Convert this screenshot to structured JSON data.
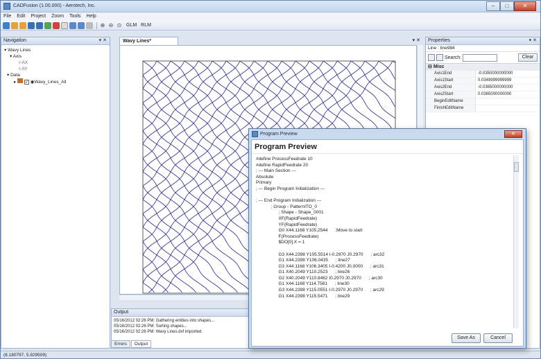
{
  "window": {
    "title": "CADFusion (1.00.000) - Aerotech, Inc."
  },
  "menu": [
    "File",
    "Edit",
    "Project",
    "Zoom",
    "Tools",
    "Help"
  ],
  "toolbar": {
    "glm": "GLM",
    "rlm": "RLM"
  },
  "navigation": {
    "title": "Navigation",
    "pin": "▾ ✕",
    "tree": {
      "root": "Wavy Lines",
      "axis": "Axis",
      "ax": "AX",
      "ay": "AY",
      "data": "Data",
      "layer": "Wavy_Lines_All"
    }
  },
  "document": {
    "tab": "Wavy Lines*",
    "controls": "▾ ✕"
  },
  "output": {
    "title": "Output",
    "lines": [
      "05/16/2012 02:26 PM: Gathering entities into shapes...",
      "05/16/2012 02:26 PM: Sorting shapes...",
      "05/16/2012 02:26 PM: Wavy Lines.dxf imported."
    ],
    "tabs": [
      "Errors",
      "Output"
    ]
  },
  "properties": {
    "title": "Properties",
    "pin": "▾ ✕",
    "subject": "Line : line984",
    "search_label": "Search:",
    "clear": "Clear",
    "group": "Misc",
    "rows": [
      {
        "name": "Axis1End",
        "value": "-0.0350000000000"
      },
      {
        "name": "Axis1Start",
        "value": "0.0349999999999"
      },
      {
        "name": "Axis2End",
        "value": "-0.0365000000000"
      },
      {
        "name": "Axis2Start",
        "value": "0.0365000000000"
      },
      {
        "name": "BeginEditName",
        "value": ""
      },
      {
        "name": "FinishEditName",
        "value": ""
      }
    ]
  },
  "dialog": {
    "title": "Program Preview",
    "heading": "Program Preview",
    "code": [
      "#define ProcessFeedrate 10",
      "#define RapidFeedrate 20",
      "; --- Main Section ---",
      "Absolute",
      "Primary",
      "; --- Begin Program Initialization ---",
      "",
      "; --- End Program Initialization ---",
      "            ; Group - PatternITO_0",
      "                  ; Shape - Shape_0001",
      "                  XF(RapidFeedrate)",
      "                  YF(RapidFeedrate)",
      "                  G0 X44.1168 Y105.2544      ;Move to start",
      "                  F(ProcessFeedrate)",
      "                  $DO[0].X = 1",
      "",
      "                  G3 X44.2398 Y105.5514 I-0.2970 J0.2970      ; arc32",
      "                  G1 X44.2398 Y106.0435      ; line27",
      "                  G3 X44.1168 Y106.3405 I-0.4200 J0.0000      ; arc31",
      "                  G1 X40.2049 Y110.2523      ; line26",
      "                  G2 X40.2049 Y110.8462 I0.2970 J0.2970      ; arc30",
      "                  G1 X44.1168 Y114.7581      ; line30",
      "                  G3 X44.2398 Y115.0551 I-0.2970 J0.2970      ; arc29",
      "                  G1 X44.2398 Y115.5471      ; line29"
    ],
    "save_as": "Save As",
    "cancel": "Cancel"
  },
  "status": {
    "coords": "(8.180797, 5.929509)"
  },
  "colors": {
    "wave": "#3d3d9a",
    "accent": "#c2412a"
  }
}
